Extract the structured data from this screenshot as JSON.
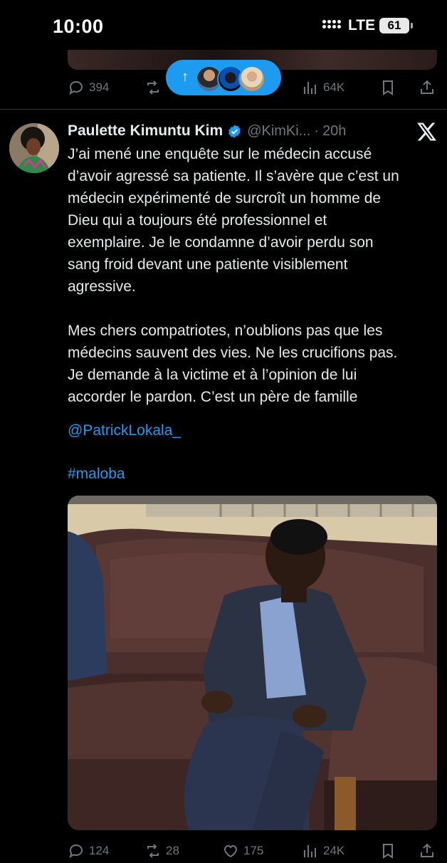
{
  "status_bar": {
    "time": "10:00",
    "network": "LTE",
    "battery": "61"
  },
  "previous_tweet": {
    "actions": {
      "replies": "394",
      "views": "64K"
    }
  },
  "new_posts_pill": {
    "icon": "arrow-up-icon"
  },
  "tweet": {
    "author_name": "Paulette Kimuntu Kim",
    "handle": "@KimKi...",
    "separator": "·",
    "time": "20h",
    "text_lines_1": [
      "J’ai mené une enquête sur le médecin accusé",
      "d’avoir agressé sa patiente. Il s’avère que c’est un",
      "médecin expérimenté de surcroît un homme de",
      "Dieu qui a toujours été professionnel et",
      "exemplaire. Je le condamne d’avoir perdu son",
      "sang froid devant une patiente visiblement",
      "agressive."
    ],
    "text_lines_2": [
      "Mes chers compatriotes, n’oublions pas que les",
      "médecins sauvent des vies. Ne les crucifions pas.",
      "Je demande à la victime et à l’opinion de lui",
      "accorder le pardon. C’est un père de famille"
    ],
    "mention": "@PatrickLokala_",
    "hashtag": "#maloba",
    "actions": {
      "replies": "124",
      "reposts": "28",
      "likes": "175",
      "views": "24K"
    }
  },
  "colors": {
    "accent": "#1d9bf0",
    "text": "#e7e9ea",
    "muted": "#71767b",
    "background": "#000000"
  }
}
